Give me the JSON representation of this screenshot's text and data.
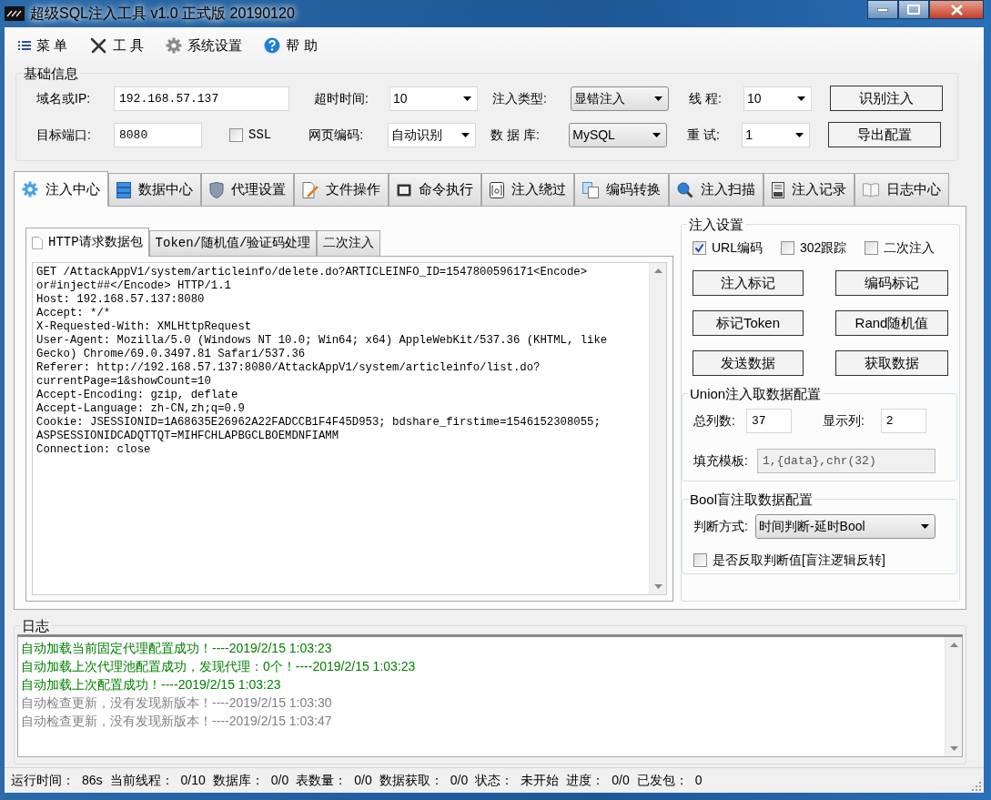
{
  "window": {
    "title": "超级SQL注入工具 v1.0 正式版 20190120"
  },
  "menu": [
    {
      "label": "菜 单"
    },
    {
      "label": "工 具"
    },
    {
      "label": "系统设置"
    },
    {
      "label": "帮 助"
    }
  ],
  "basic_info": {
    "title": "基础信息",
    "fields": [
      {
        "kind": "text",
        "label": "域名或IP:",
        "value": "192.168.57.137"
      },
      {
        "kind": "combo",
        "label": "超时时间:",
        "value": "10"
      },
      {
        "kind": "dropdown",
        "label": "注入类型:",
        "value": "显错注入"
      },
      {
        "kind": "combo",
        "label": "线 程:",
        "value": "10"
      },
      {
        "kind": "button",
        "label": "识别注入"
      },
      {
        "kind": "text",
        "label": "目标端口:",
        "value": "8080"
      },
      {
        "kind": "checkbox",
        "label": "SSL",
        "checked": false
      },
      {
        "kind": "combo",
        "label": "网页编码:",
        "value": "自动识别"
      },
      {
        "kind": "dropdown",
        "label": "数 据 库:",
        "value": "MySQL"
      },
      {
        "kind": "combo",
        "label": "重 试:",
        "value": "1"
      },
      {
        "kind": "button",
        "label": "导出配置"
      }
    ]
  },
  "tabs": [
    {
      "label": "注入中心",
      "selected": true
    },
    {
      "label": "数据中心",
      "selected": false
    },
    {
      "label": "代理设置",
      "selected": false
    },
    {
      "label": "文件操作",
      "selected": false
    },
    {
      "label": "命令执行",
      "selected": false
    },
    {
      "label": "注入绕过",
      "selected": false
    },
    {
      "label": "编码转换",
      "selected": false
    },
    {
      "label": "注入扫描",
      "selected": false
    },
    {
      "label": "注入记录",
      "selected": false
    },
    {
      "label": "日志中心",
      "selected": false
    }
  ],
  "subtabs": [
    {
      "label": "HTTP请求数据包",
      "selected": true
    },
    {
      "label": "Token/随机值/验证码处理",
      "selected": false
    },
    {
      "label": "二次注入",
      "selected": false
    }
  ],
  "request_lines": [
    "GET /AttackAppV1/system/articleinfo/delete.do?ARTICLEINFO_ID=1547800596171<Encode>",
    "or#inject##</Encode> HTTP/1.1",
    "Host: 192.168.57.137:8080",
    "Accept: */*",
    "X-Requested-With: XMLHttpRequest",
    "User-Agent: Mozilla/5.0 (Windows NT 10.0; Win64; x64) AppleWebKit/537.36 (KHTML, like",
    "Gecko) Chrome/69.0.3497.81 Safari/537.36",
    "Referer: http://192.168.57.137:8080/AttackAppV1/system/articleinfo/list.do?",
    "currentPage=1&showCount=10",
    "Accept-Encoding: gzip, deflate",
    "Accept-Language: zh-CN,zh;q=0.9",
    "Cookie: JSESSIONID=1A68635E26962A22FADCCB1F4F45D953; bdshare_firstime=1546152308055;",
    "ASPSESSIONIDCADQTTQT=MIHFCHLAPBGCLBOEMDNFIAMM",
    "Connection: close"
  ],
  "injection_settings": {
    "title": "注入设置",
    "options": [
      {
        "label": "URL编码",
        "checked": true
      },
      {
        "label": "302跟踪",
        "checked": false
      },
      {
        "label": "二次注入",
        "checked": false
      }
    ],
    "buttons": [
      "注入标记",
      "编码标记",
      "标记Token",
      "Rand随机值",
      "发送数据",
      "获取数据"
    ]
  },
  "union_config": {
    "title": "Union注入取数据配置",
    "total_columns": {
      "label": "总列数:",
      "value": "37"
    },
    "display_column": {
      "label": "显示列:",
      "value": "2"
    },
    "fill_template": {
      "label": "填充模板:",
      "value": "1,{data},chr(32)",
      "disabled": true
    }
  },
  "bool_config": {
    "title": "Bool盲注取数据配置",
    "method": {
      "label": "判断方式:",
      "value": "时间判断-延时Bool"
    },
    "invert": {
      "label": "是否反取判断值[盲注逻辑反转]",
      "checked": false
    }
  },
  "log": {
    "title": "日志",
    "entries": [
      {
        "text": "自动加载当前固定代理配置成功！----2019/2/15 1:03:23",
        "color": "#008000"
      },
      {
        "text": "自动加载上次代理池配置成功，发现代理：0个！----2019/2/15 1:03:23",
        "color": "#008000"
      },
      {
        "text": "自动加载上次配置成功！----2019/2/15 1:03:23",
        "color": "#008000"
      },
      {
        "text": "自动检查更新，没有发现新版本！----2019/2/15 1:03:30",
        "color": "#808080"
      },
      {
        "text": "自动检查更新，没有发现新版本！----2019/2/15 1:03:47",
        "color": "#808080"
      }
    ]
  },
  "status_bar": [
    {
      "label": "运行时间：",
      "value": "86s"
    },
    {
      "label": "当前线程：",
      "value": "0/10"
    },
    {
      "label": "数据库：",
      "value": "0/0"
    },
    {
      "label": "表数量：",
      "value": "0/0"
    },
    {
      "label": "数据获取：",
      "value": "0/0"
    },
    {
      "label": "状态：",
      "value": "未开始"
    },
    {
      "label": "进度：",
      "value": "0/0"
    },
    {
      "label": "已发包：",
      "value": "0"
    }
  ]
}
